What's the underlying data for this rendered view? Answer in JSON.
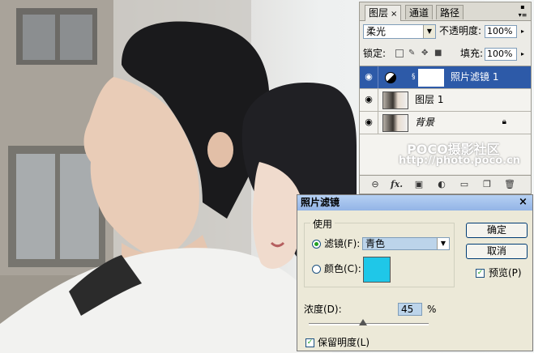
{
  "layers_panel": {
    "tabs": [
      {
        "label": "图层",
        "close": "×"
      },
      {
        "label": "通道"
      },
      {
        "label": "路径"
      }
    ],
    "blend_mode": "柔光",
    "opacity_label": "不透明度:",
    "opacity_value": "100%",
    "lock_label": "锁定:",
    "fill_label": "填充:",
    "fill_value": "100%",
    "layers": [
      {
        "name": "照片滤镜 1",
        "selected": true
      },
      {
        "name": "图层 1",
        "selected": false
      },
      {
        "name": "背景",
        "selected": false
      }
    ],
    "watermark_top": "POCO摄影社区",
    "watermark_url": "http://photo.poco.cn",
    "footer_fx": "fx."
  },
  "photo_filter_dialog": {
    "title": "照片滤镜",
    "close": "×",
    "use_label": "使用",
    "filter_label": "滤镜(F):",
    "filter_value": "青色",
    "color_label": "颜色(C):",
    "color_swatch": "#1fc7e8",
    "ok_label": "确定",
    "cancel_label": "取消",
    "preview_label": "预览(P)",
    "density_label": "浓度(D):",
    "density_value": "45",
    "density_unit": "%",
    "density_fraction": 0.45,
    "preserve_label": "保留明度(L)"
  },
  "colors": {
    "selection": "#2d5aa8",
    "dialog_title": "#93b4e6"
  }
}
